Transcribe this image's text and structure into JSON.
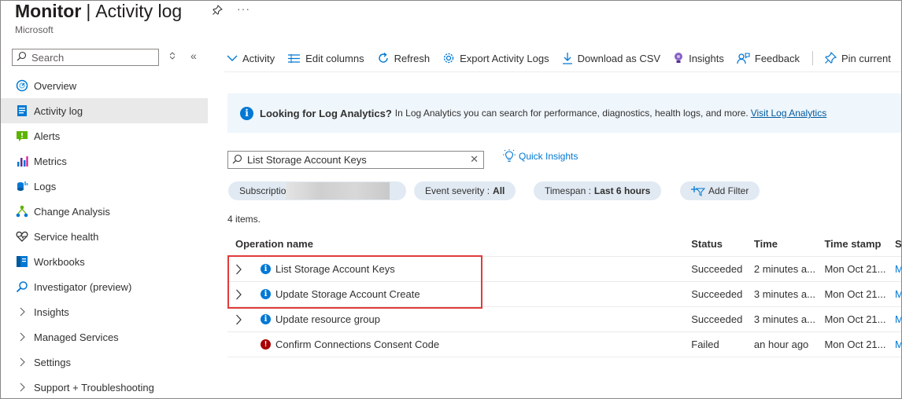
{
  "header": {
    "title_bold": "Monitor",
    "separator": "|",
    "title_rest": "Activity log",
    "subtitle": "Microsoft",
    "more": "···"
  },
  "sidebar": {
    "search_placeholder": "Search",
    "items": [
      {
        "label": "Overview",
        "icon": "overview-icon"
      },
      {
        "label": "Activity log",
        "icon": "activity-log-icon",
        "active": true
      },
      {
        "label": "Alerts",
        "icon": "alerts-icon"
      },
      {
        "label": "Metrics",
        "icon": "metrics-icon"
      },
      {
        "label": "Logs",
        "icon": "logs-icon"
      },
      {
        "label": "Change Analysis",
        "icon": "change-analysis-icon"
      },
      {
        "label": "Service health",
        "icon": "service-health-icon"
      },
      {
        "label": "Workbooks",
        "icon": "workbooks-icon"
      },
      {
        "label": "Investigator (preview)",
        "icon": "investigator-icon"
      },
      {
        "label": "Insights",
        "icon": "chevron-right-icon"
      },
      {
        "label": "Managed Services",
        "icon": "chevron-right-icon"
      },
      {
        "label": "Settings",
        "icon": "chevron-right-icon"
      },
      {
        "label": "Support + Troubleshooting",
        "icon": "chevron-right-icon"
      }
    ]
  },
  "toolbar": {
    "activity": "Activity",
    "edit_columns": "Edit columns",
    "refresh": "Refresh",
    "export": "Export Activity Logs",
    "download": "Download as CSV",
    "insights": "Insights",
    "feedback": "Feedback",
    "pin": "Pin current"
  },
  "banner": {
    "title": "Looking for Log Analytics?",
    "description": "In Log Analytics you can search for performance, diagnostics, health logs, and more.",
    "link": "Visit Log Analytics"
  },
  "filters": {
    "search_value": "List Storage Account Keys",
    "quick_insights": "Quick Insights",
    "subscription_label": "Subscriptio",
    "severity_label": "Event severity :",
    "severity_value": "All",
    "timespan_label": "Timespan :",
    "timespan_value": "Last 6 hours",
    "add_filter": "Add Filter"
  },
  "item_count": "4 items.",
  "table": {
    "headers": [
      "Operation name",
      "Status",
      "Time",
      "Time stamp",
      "S"
    ],
    "rows": [
      {
        "operation": "List Storage Account Keys",
        "status": "Succeeded",
        "time": "2 minutes a...",
        "timestamp": "Mon Oct 21...",
        "extra": "M",
        "level": "info",
        "expandable": true
      },
      {
        "operation": "Update Storage Account Create",
        "status": "Succeeded",
        "time": "3 minutes a...",
        "timestamp": "Mon Oct 21...",
        "extra": "M",
        "level": "info",
        "expandable": true
      },
      {
        "operation": "Update resource group",
        "status": "Succeeded",
        "time": "3 minutes a...",
        "timestamp": "Mon Oct 21...",
        "extra": "M",
        "level": "info",
        "expandable": true
      },
      {
        "operation": "Confirm Connections Consent Code",
        "status": "Failed",
        "time": "an hour ago",
        "timestamp": "Mon Oct 21...",
        "extra": "M",
        "level": "error",
        "expandable": false
      }
    ]
  },
  "colors": {
    "accent": "#0078d4",
    "error": "#a80000",
    "highlight": "#e03b3b",
    "banner_bg": "#eff6fc",
    "pill_bg": "#e1eaf3"
  }
}
